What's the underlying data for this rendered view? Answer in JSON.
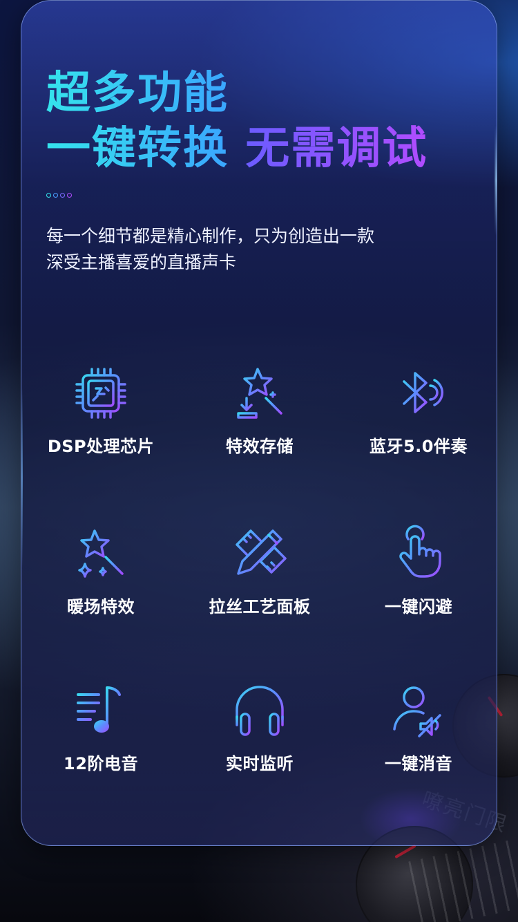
{
  "headline": {
    "line1": "超多功能",
    "line2_part1": "一键转换",
    "line2_part2": "无需调试"
  },
  "colors": {
    "cyan_start": "#35e3ec",
    "cyan_end": "#3aa6ff",
    "purple_start": "#6b5cff",
    "purple_end": "#b14cff",
    "dot_colors": [
      "#35e3ec",
      "#4aa0ff",
      "#7a6bff",
      "#b14cff"
    ]
  },
  "description": {
    "line1": "每一个细节都是精心制作，只为创造出一款",
    "line2": "深受主播喜爱的直播声卡"
  },
  "features": [
    {
      "label": "DSP处理芯片",
      "icon": "chip-icon"
    },
    {
      "label": "特效存储",
      "icon": "magic-wand-storage-icon"
    },
    {
      "label": "蓝牙5.0伴奏",
      "icon": "bluetooth-icon"
    },
    {
      "label": "暖场特效",
      "icon": "star-wand-icon"
    },
    {
      "label": "拉丝工艺面板",
      "icon": "pencil-ruler-icon"
    },
    {
      "label": "一键闪避",
      "icon": "touch-hand-icon"
    },
    {
      "label": "12阶电音",
      "icon": "music-note-icon"
    },
    {
      "label": "实时监听",
      "icon": "headphones-icon"
    },
    {
      "label": "一键消音",
      "icon": "user-mute-icon"
    }
  ],
  "background": {
    "stamp_text": "嘹亮门限"
  }
}
